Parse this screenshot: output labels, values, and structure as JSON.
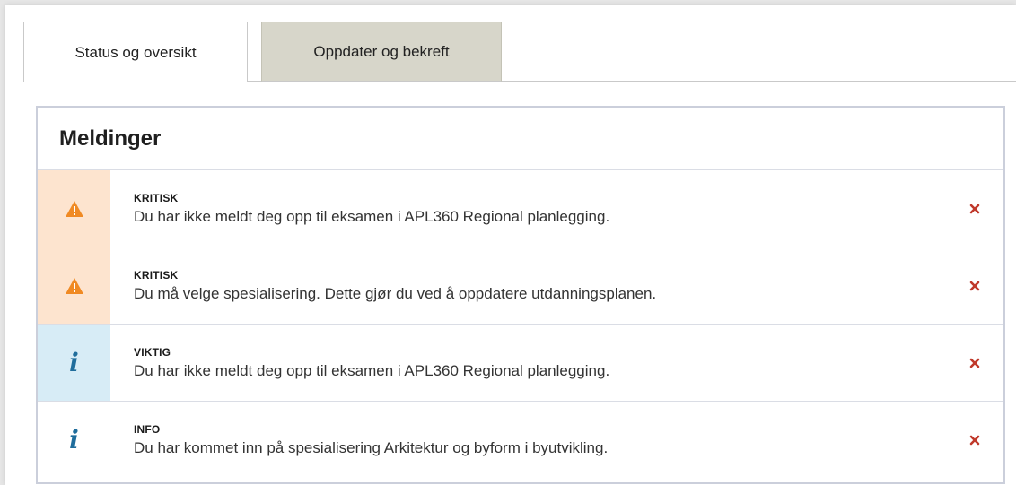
{
  "tabs": [
    {
      "label": "Status og oversikt",
      "active": true
    },
    {
      "label": "Oppdater og bekreft",
      "active": false
    }
  ],
  "panel": {
    "title": "Meldinger"
  },
  "messages": [
    {
      "level": "KRITISK",
      "text": "Du har ikke meldt deg opp til eksamen i APL360 Regional planlegging.",
      "icon": "warning-icon",
      "type": "critical"
    },
    {
      "level": "KRITISK",
      "text": "Du må velge spesialisering. Dette gjør du ved å oppdatere utdanningsplanen.",
      "icon": "warning-icon",
      "type": "critical"
    },
    {
      "level": "VIKTIG",
      "text": "Du har ikke meldt deg opp til eksamen i APL360 Regional planlegging.",
      "icon": "info-icon",
      "type": "important"
    },
    {
      "level": "INFO",
      "text": "Du har kommet inn på spesialisering Arkitektur og byform i byutvikling.",
      "icon": "info-icon",
      "type": "info"
    }
  ],
  "colors": {
    "critical_bg": "#fde4cf",
    "important_bg": "#d7ecf6",
    "warning_icon": "#f08a24",
    "info_icon": "#1f6d9c",
    "close_icon": "#c0392b",
    "inactive_tab": "#d7d6ca"
  }
}
